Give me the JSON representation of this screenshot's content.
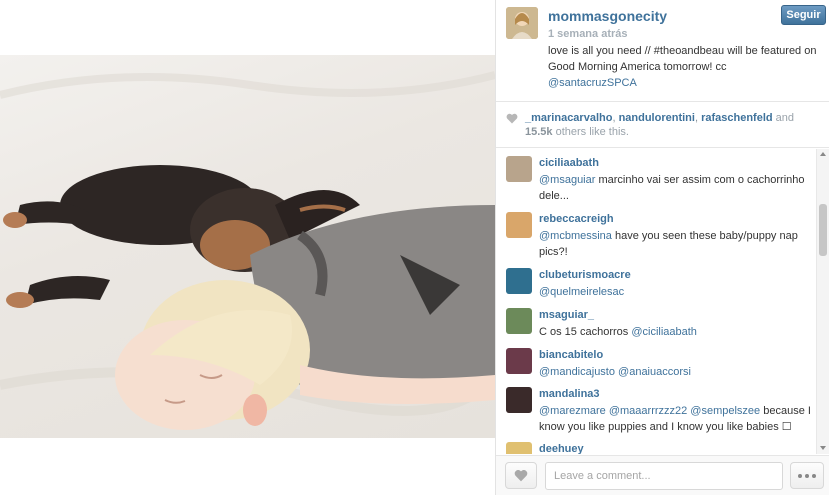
{
  "post": {
    "owner": "mommasgonecity",
    "follow_label": "Seguir",
    "timestamp": "1 semana atrás",
    "caption_text": "love is all you need // #theoandbeau will be featured on Good Morning America tomorrow! cc",
    "caption_mention": "@santacruzSPCA"
  },
  "likes": {
    "users": [
      "_marinacarvalho",
      "nandulorentini",
      "rafaschenfeld"
    ],
    "and_label": "and",
    "count": "15.5k",
    "suffix": "others like this."
  },
  "comments": [
    {
      "user": "ciciliaabath",
      "mention": "@msaguiar",
      "text": "  marcinho vai ser assim com o cachorrinho dele...",
      "avatar_color": "#b8a48c"
    },
    {
      "user": "rebeccacreigh",
      "mention": "@mcbmessina",
      "text": " have you seen these baby/puppy nap pics?!",
      "avatar_color": "#d9a66a"
    },
    {
      "user": "clubeturismoacre",
      "mention": "@quelmeirelesac",
      "text": "",
      "avatar_color": "#2f6f8f"
    },
    {
      "user": "msaguiar_",
      "prefix": "C os 15 cachorros ",
      "mention": "@ciciliaabath",
      "text": "",
      "avatar_color": "#6c8a5a"
    },
    {
      "user": "biancabitelo",
      "mention": "@mandicajusto @anaiuaccorsi",
      "text": "",
      "avatar_color": "#6b3a4a"
    },
    {
      "user": "mandalina3",
      "mention": "@marezmare @maaarrrzzz22 @sempelszee",
      "text": " because I know you like puppies and I know you like babies ☐",
      "avatar_color": "#3a2a2a"
    },
    {
      "user": "deehuey",
      "mention": "",
      "text": "",
      "avatar_color": "#e0c070"
    }
  ],
  "footer": {
    "comment_placeholder": "Leave a comment..."
  },
  "colors": {
    "link": "#3f729b",
    "follow_button": "#3f729b"
  }
}
